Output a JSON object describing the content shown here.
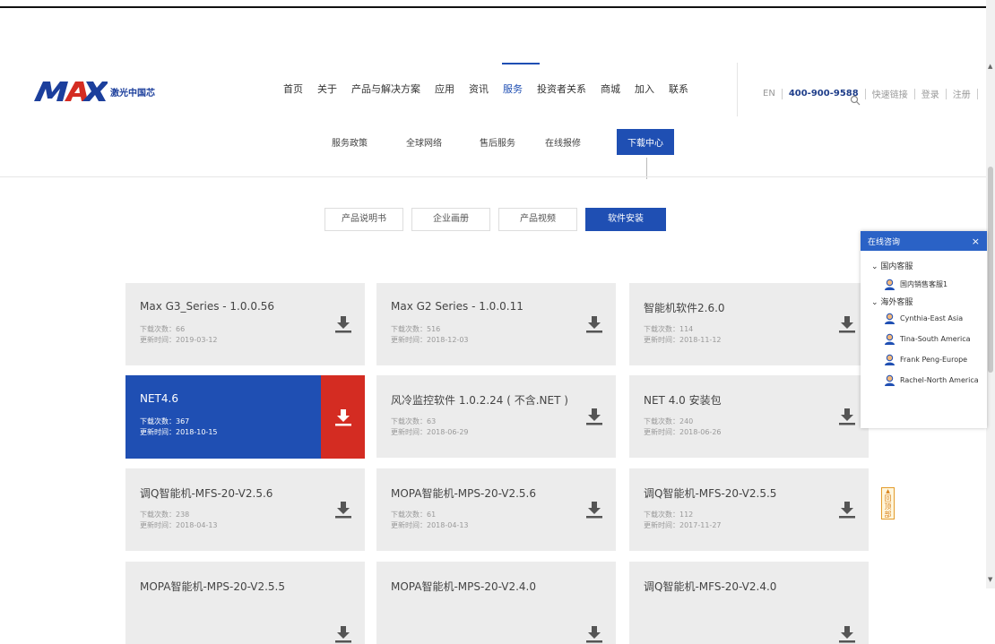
{
  "header": {
    "logo_text": "MAX",
    "logo_cn": "激光中国芯",
    "nav": [
      "首页",
      "关于",
      "产品与解决方案",
      "应用",
      "资讯",
      "服务",
      "投资者关系",
      "商城",
      "加入",
      "联系"
    ],
    "nav_active": "服务",
    "lang": "EN",
    "phone": "400-900-9588",
    "quick_links": "快速链接",
    "login": "登录",
    "register": "注册"
  },
  "subnav": {
    "items": [
      "服务政策",
      "全球网络",
      "售后服务",
      "在线报修",
      "下载中心"
    ],
    "active": "下载中心"
  },
  "tabs": {
    "items": [
      "产品说明书",
      "企业画册",
      "产品视频",
      "软件安装"
    ],
    "active": "软件安装"
  },
  "downloads": {
    "count_label": "下载次数：",
    "time_label": "更新时间：",
    "items": [
      {
        "title": "Max G3_Series - 1.0.0.56",
        "count": "66",
        "date": "2019-03-12"
      },
      {
        "title": "Max G2 Series - 1.0.0.11",
        "count": "516",
        "date": "2018-12-03"
      },
      {
        "title": "智能机软件2.6.0",
        "count": "114",
        "date": "2018-11-12"
      },
      {
        "title": "NET4.6",
        "count": "367",
        "date": "2018-10-15"
      },
      {
        "title": "风冷监控软件 1.0.2.24 ( 不含.NET )",
        "count": "63",
        "date": "2018-06-29"
      },
      {
        "title": "NET 4.0 安装包",
        "count": "240",
        "date": "2018-06-26"
      },
      {
        "title": "调Q智能机-MFS-20-V2.5.6",
        "count": "238",
        "date": "2018-04-13"
      },
      {
        "title": "MOPA智能机-MPS-20-V2.5.6",
        "count": "61",
        "date": "2018-04-13"
      },
      {
        "title": "调Q智能机-MFS-20-V2.5.5",
        "count": "112",
        "date": "2017-11-27"
      },
      {
        "title": "MOPA智能机-MPS-20-V2.5.5",
        "count": "",
        "date": ""
      },
      {
        "title": "MOPA智能机-MPS-20-V2.4.0",
        "count": "",
        "date": ""
      },
      {
        "title": "调Q智能机-MFS-20-V2.4.0",
        "count": "",
        "date": ""
      }
    ]
  },
  "chat": {
    "title": "在线咨询",
    "close": "×",
    "domestic_group": "国内客服",
    "domestic_agents": [
      "国内销售客服1"
    ],
    "overseas_group": "海外客服",
    "overseas_agents": [
      "Cynthia-East Asia",
      "Tina-South America",
      "Frank Peng-Europe",
      "Rachel-North America"
    ]
  },
  "back_to_top": "回顶部",
  "colors": {
    "primary": "#1f4fb3",
    "accent_red": "#d42c22",
    "card_bg": "#ececec"
  },
  "icons": {
    "download": "download-icon",
    "search": "search-icon",
    "avatar": "agent-avatar-icon"
  }
}
